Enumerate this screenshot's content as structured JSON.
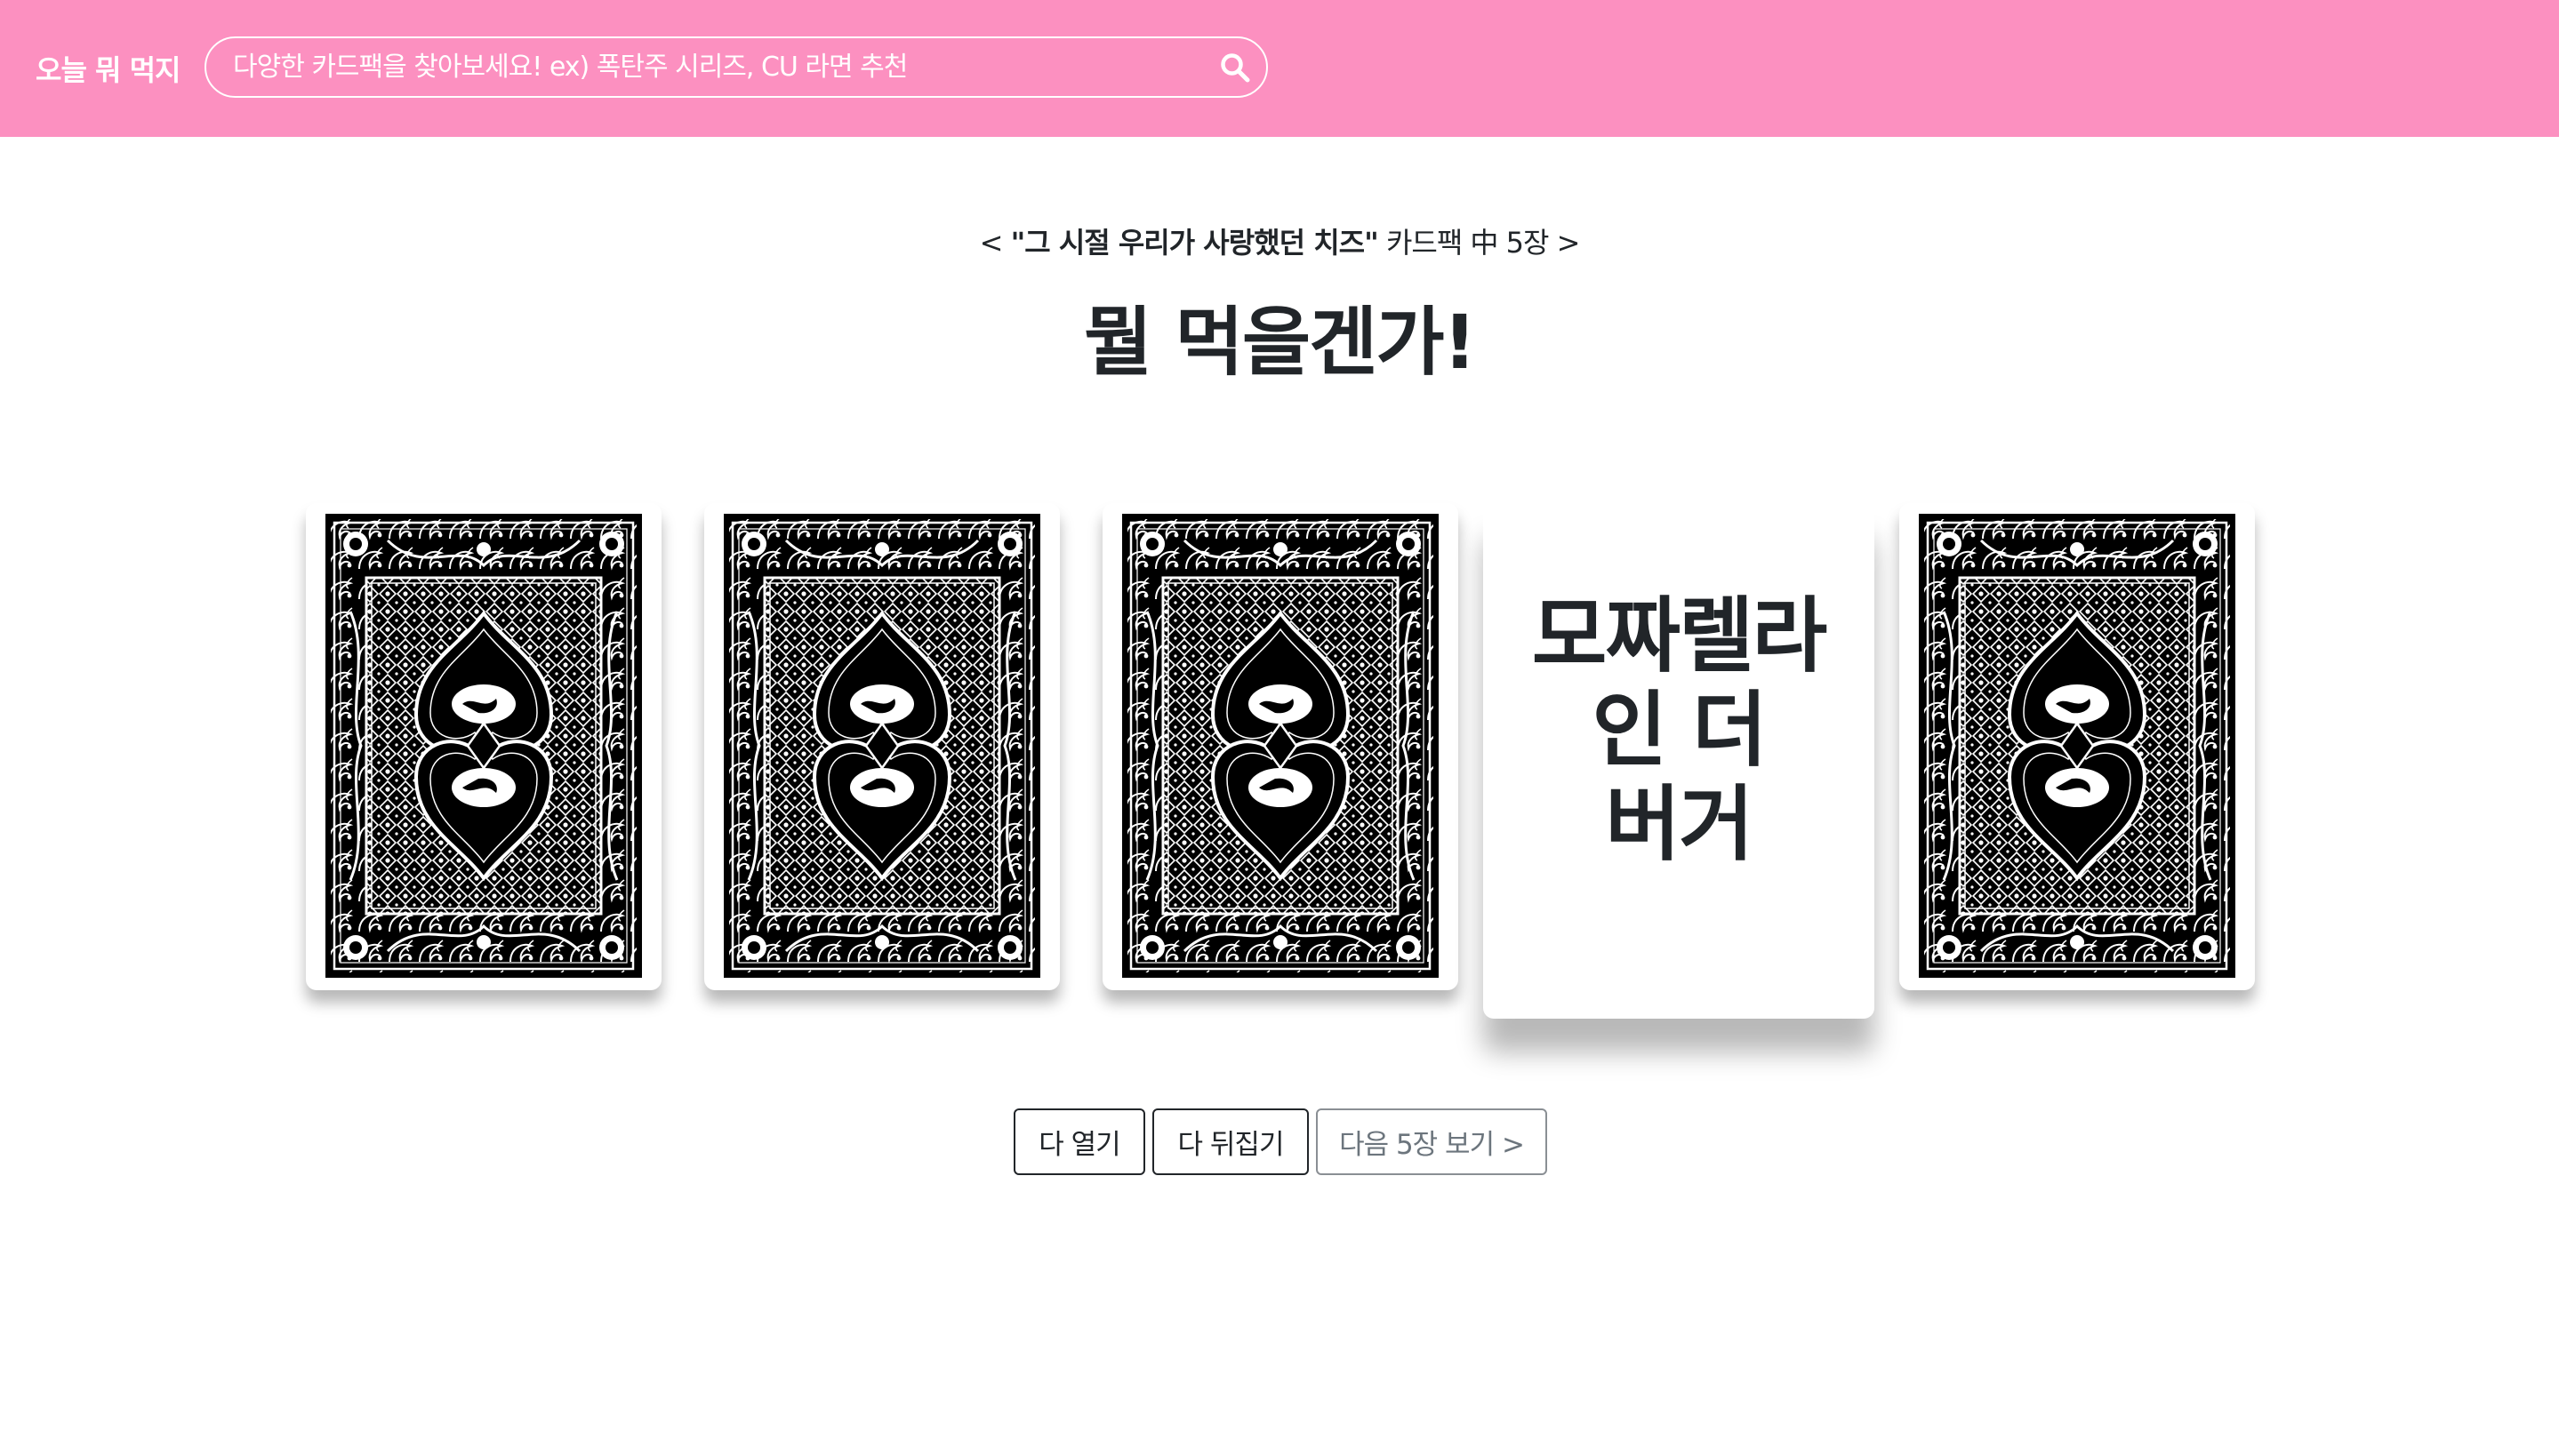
{
  "header": {
    "brand": "오늘 뭐 먹지",
    "search_placeholder": "다양한 카드팩을 찾아보세요! ex) 폭탄주 시리즈, CU 라면 추천",
    "search_icon": "search-icon"
  },
  "main": {
    "subtitle_prefix": "< ",
    "subtitle_pack": "\"그 시절 우리가 사랑했던 치즈\"",
    "subtitle_suffix": " 카드팩 中 5장 >",
    "title": "뭘 먹을겐가!"
  },
  "cards": [
    {
      "state": "back"
    },
    {
      "state": "back"
    },
    {
      "state": "back"
    },
    {
      "state": "open",
      "label": "모짜렐라 인 더 버거"
    },
    {
      "state": "back"
    }
  ],
  "buttons": {
    "open_all": "다 열기",
    "flip_all": "다 뒤집기",
    "next_five": "다음 5장 보기 >"
  },
  "colors": {
    "header_bg": "#fc90c0",
    "text": "#212529",
    "card_back": "#000000"
  }
}
